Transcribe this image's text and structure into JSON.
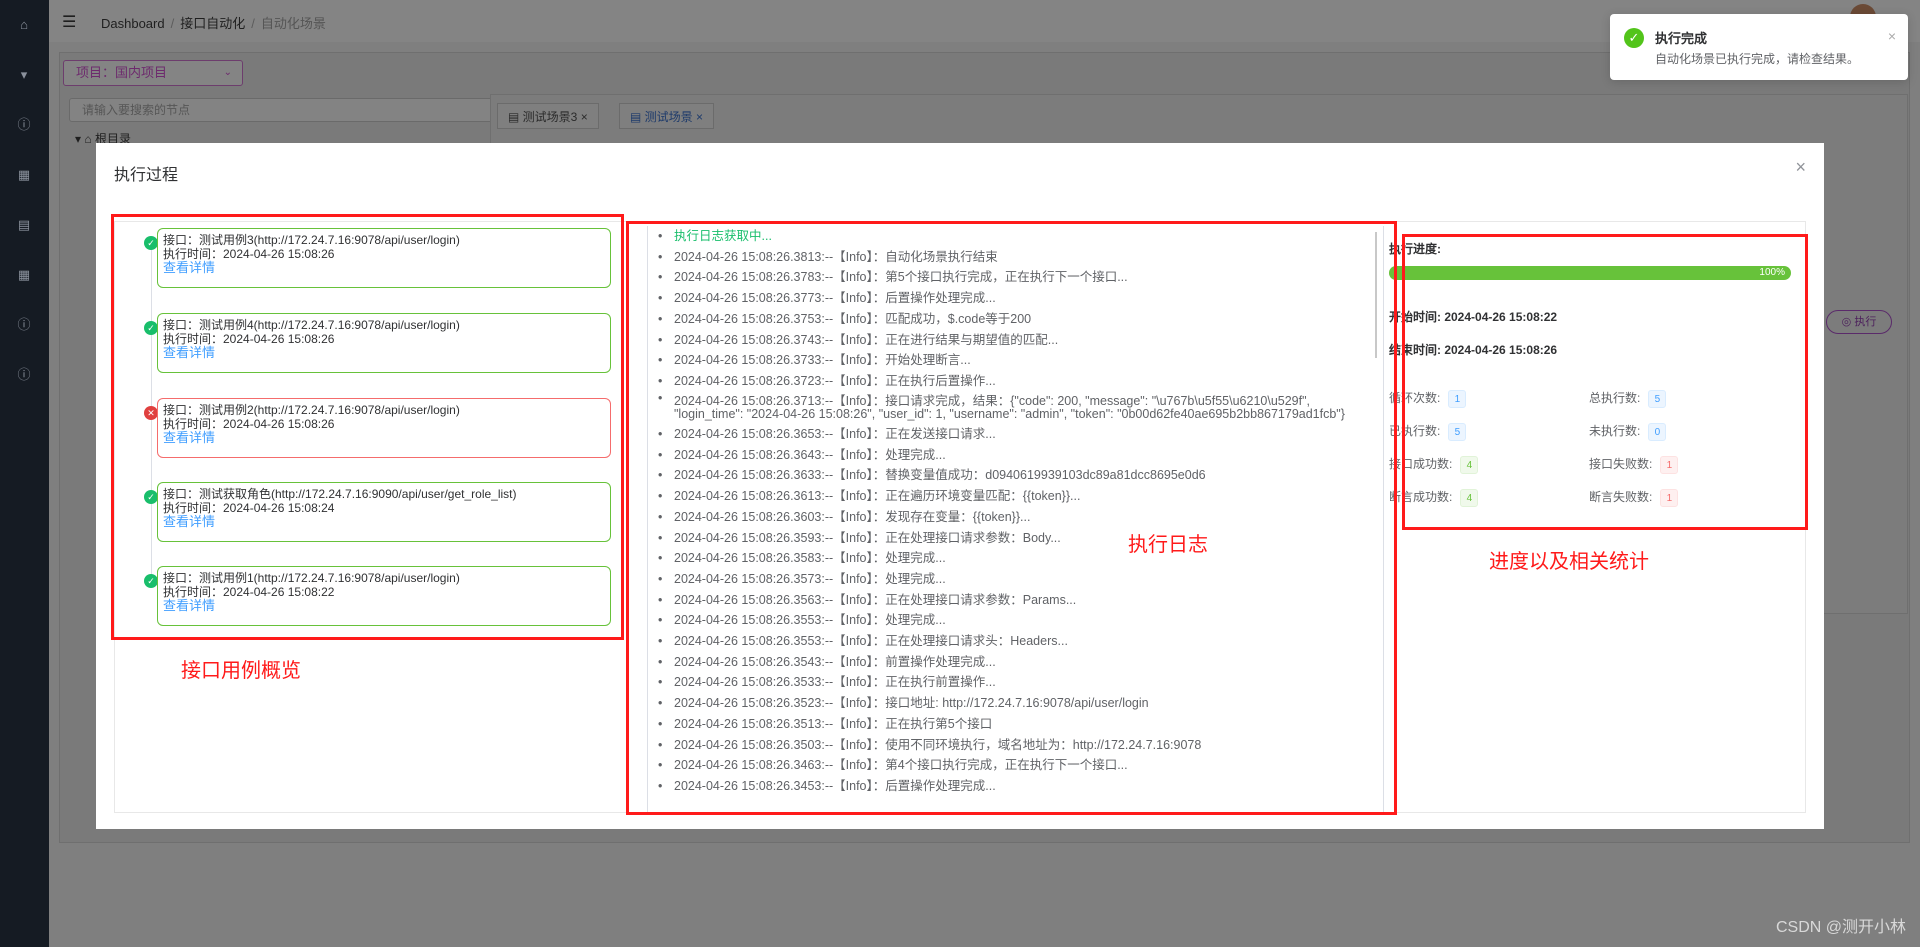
{
  "background": {
    "breadcrumb": [
      "Dashboard",
      "接口自动化",
      "自动化场景"
    ],
    "project_select": "项目：国内项目",
    "tree_search_placeholder": "请输入要搜索的节点",
    "tree_root": "根目录",
    "tabs": [
      {
        "label": "测试场景3",
        "active": false
      },
      {
        "label": "测试场景",
        "active": true
      }
    ],
    "run_button": "执行"
  },
  "toast": {
    "title": "执行完成",
    "message": "自动化场景已执行完成，请检查结果。"
  },
  "modal": {
    "title": "执行过程"
  },
  "cases": [
    {
      "status": "success",
      "title": "接口：测试用例3(http://172.24.7.16:9078/api/user/login)",
      "time": "执行时间：2024-04-26 15:08:26",
      "link": "查看详情"
    },
    {
      "status": "success",
      "title": "接口：测试用例4(http://172.24.7.16:9078/api/user/login)",
      "time": "执行时间：2024-04-26 15:08:26",
      "link": "查看详情"
    },
    {
      "status": "fail",
      "title": "接口：测试用例2(http://172.24.7.16:9078/api/user/login)",
      "time": "执行时间：2024-04-26 15:08:26",
      "link": "查看详情"
    },
    {
      "status": "success",
      "title": "接口：测试获取角色(http://172.24.7.16:9090/api/user/get_role_list)",
      "time": "执行时间：2024-04-26 15:08:24",
      "link": "查看详情"
    },
    {
      "status": "success",
      "title": "接口：测试用例1(http://172.24.7.16:9078/api/user/login)",
      "time": "执行时间：2024-04-26 15:08:22",
      "link": "查看详情"
    }
  ],
  "logs": [
    "执行日志获取中...",
    "2024-04-26 15:08:26.3813:--【Info】：自动化场景执行结束",
    "2024-04-26 15:08:26.3783:--【Info】：第5个接口执行完成，正在执行下一个接口...",
    "2024-04-26 15:08:26.3773:--【Info】：后置操作处理完成...",
    "2024-04-26 15:08:26.3753:--【Info】：匹配成功，$.code等于200",
    "2024-04-26 15:08:26.3743:--【Info】：正在进行结果与期望值的匹配...",
    "2024-04-26 15:08:26.3733:--【Info】：开始处理断言...",
    "2024-04-26 15:08:26.3723:--【Info】：正在执行后置操作...",
    "2024-04-26 15:08:26.3713:--【Info】：接口请求完成，结果：{\"code\": 200, \"message\": \"\\u767b\\u5f55\\u6210\\u529f\", \"login_time\": \"2024-04-26 15:08:26\", \"user_id\": 1, \"username\": \"admin\", \"token\": \"0b00d62fe40ae695b2bb867179ad1fcb\"}",
    "2024-04-26 15:08:26.3653:--【Info】：正在发送接口请求...",
    "2024-04-26 15:08:26.3643:--【Info】：处理完成...",
    "2024-04-26 15:08:26.3633:--【Info】：替换变量值成功：d0940619939103dc89a81dcc8695e0d6",
    "2024-04-26 15:08:26.3613:--【Info】：正在遍历环境变量匹配：{{token}}...",
    "2024-04-26 15:08:26.3603:--【Info】：发现存在变量：{{token}}...",
    "2024-04-26 15:08:26.3593:--【Info】：正在处理接口请求参数：Body...",
    "2024-04-26 15:08:26.3583:--【Info】：处理完成...",
    "2024-04-26 15:08:26.3573:--【Info】：处理完成...",
    "2024-04-26 15:08:26.3563:--【Info】：正在处理接口请求参数：Params...",
    "2024-04-26 15:08:26.3553:--【Info】：处理完成...",
    "2024-04-26 15:08:26.3553:--【Info】：正在处理接口请求头：Headers...",
    "2024-04-26 15:08:26.3543:--【Info】：前置操作处理完成...",
    "2024-04-26 15:08:26.3533:--【Info】：正在执行前置操作...",
    "2024-04-26 15:08:26.3523:--【Info】：接口地址: http://172.24.7.16:9078/api/user/login",
    "2024-04-26 15:08:26.3513:--【Info】：正在执行第5个接口",
    "2024-04-26 15:08:26.3503:--【Info】：使用不同环境执行，域名地址为：http://172.24.7.16:9078",
    "2024-04-26 15:08:26.3463:--【Info】：第4个接口执行完成，正在执行下一个接口...",
    "2024-04-26 15:08:26.3453:--【Info】：后置操作处理完成..."
  ],
  "stats": {
    "progress_label": "执行进度:",
    "progress_percent": 100,
    "progress_text": "100%",
    "start_time": "开始时间:  2024-04-26 15:08:22",
    "end_time": "结束时间:  2024-04-26 15:08:26",
    "loop_label": "循环次数:",
    "loop_value": "1",
    "total_label": "总执行数:",
    "total_value": "5",
    "done_label": "已执行数:",
    "done_value": "5",
    "undone_label": "未执行数:",
    "undone_value": "0",
    "api_ok_label": "接口成功数:",
    "api_ok_value": "4",
    "api_fail_label": "接口失败数:",
    "api_fail_value": "1",
    "assert_ok_label": "断言成功数:",
    "assert_ok_value": "4",
    "assert_fail_label": "断言失败数:",
    "assert_fail_value": "1"
  },
  "annotations": {
    "cases_label": "接口用例概览",
    "logs_label": "执行日志",
    "stats_label": "进度以及相关统计"
  },
  "watermark": "CSDN @测开小林"
}
